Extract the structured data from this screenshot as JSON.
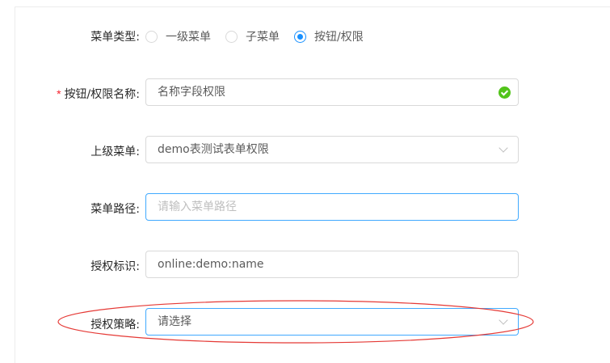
{
  "form": {
    "menu_type": {
      "label": "菜单类型:",
      "options": [
        "一级菜单",
        "子菜单",
        "按钮/权限"
      ],
      "selected_index": 2
    },
    "perm_name": {
      "label": "按钮/权限名称:",
      "required_mark": "*",
      "value": "名称字段权限",
      "status": "valid"
    },
    "parent_menu": {
      "label": "上级菜单:",
      "value": "demo表测试表单权限"
    },
    "menu_path": {
      "label": "菜单路径:",
      "placeholder": "请输入菜单路径"
    },
    "auth_key": {
      "label": "授权标识:",
      "value": "online:demo:name"
    },
    "auth_strategy": {
      "label": "授权策略:",
      "placeholder": "请选择"
    }
  },
  "colors": {
    "primary": "#1890ff",
    "success": "#52c41a",
    "required": "#f5222d",
    "annotation": "#e53935"
  },
  "icons": {
    "success": "check-circle-icon",
    "dropdown": "chevron-down-icon"
  }
}
